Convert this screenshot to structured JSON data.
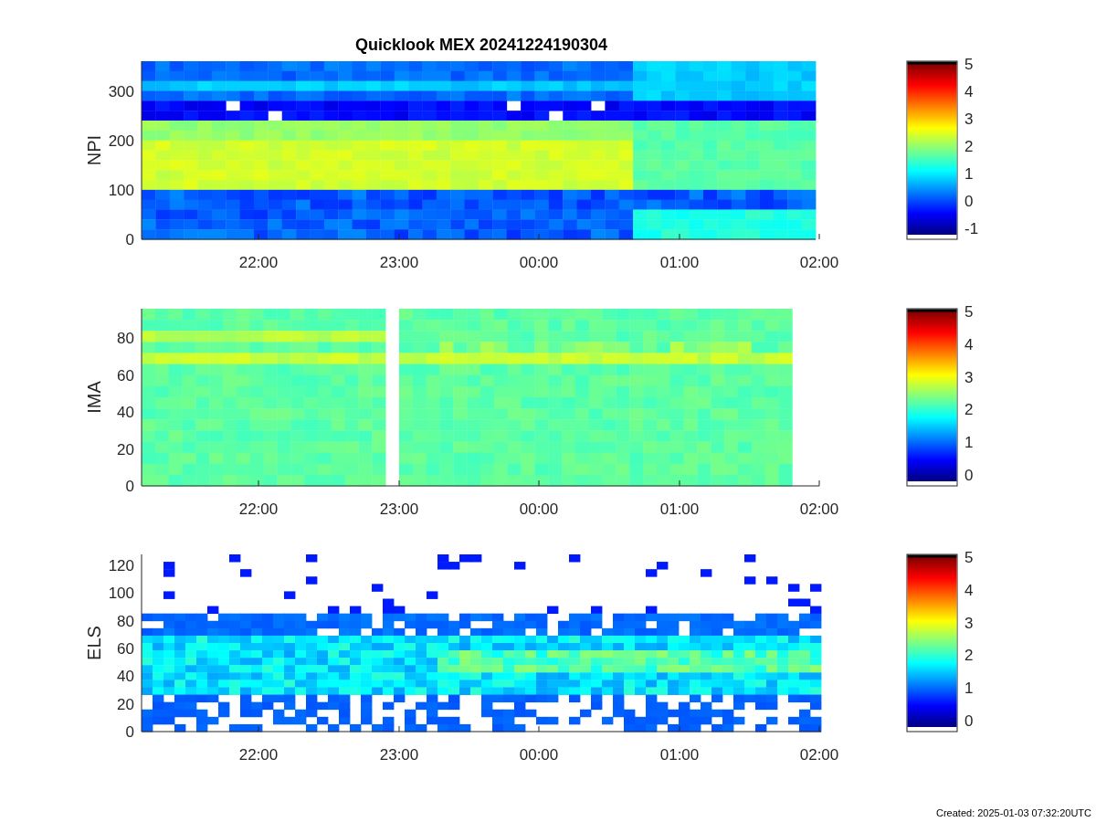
{
  "title": "Quicklook MEX 20241224190304",
  "panels": [
    {
      "kind": "npi",
      "ylabel": "NPI",
      "yticks": [
        "300",
        "200",
        "100",
        "0"
      ],
      "xticks": [
        "22:00",
        "23:00",
        "00:00",
        "01:00",
        "02:00"
      ],
      "colorbar_ticks": [
        "5",
        "4",
        "3",
        "2",
        "1",
        "0",
        "-1"
      ]
    },
    {
      "kind": "ima",
      "ylabel": "IMA",
      "yticks": [
        "80",
        "60",
        "40",
        "20",
        "0"
      ],
      "xticks": [
        "22:00",
        "23:00",
        "00:00",
        "01:00",
        "02:00"
      ],
      "colorbar_ticks": [
        "5",
        "4",
        "3",
        "2",
        "1",
        "0"
      ]
    },
    {
      "kind": "els",
      "ylabel": "ELS",
      "yticks": [
        "120",
        "100",
        "80",
        "60",
        "40",
        "20",
        "0"
      ],
      "xticks": [
        "22:00",
        "23:00",
        "00:00",
        "01:00",
        "02:00"
      ],
      "colorbar_ticks": [
        "5",
        "4",
        "3",
        "2",
        "1",
        "0"
      ]
    }
  ],
  "footer": "Created: 2025-01-03 07:32:20UTC"
}
